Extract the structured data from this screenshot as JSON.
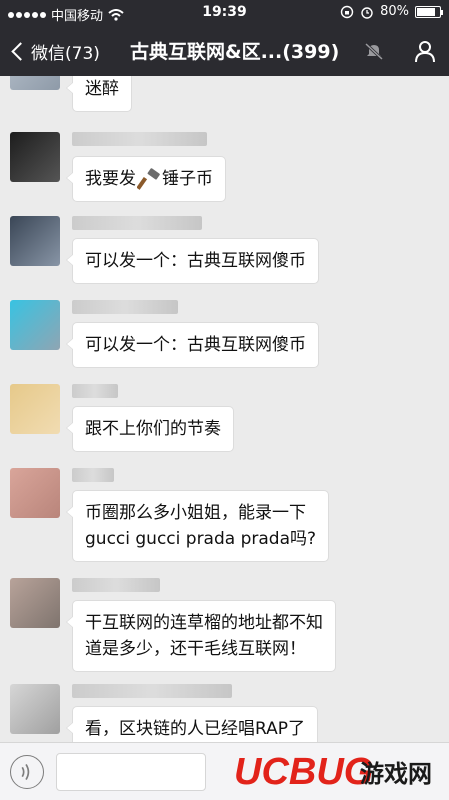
{
  "status_bar": {
    "carrier": "中国移动",
    "time": "19:39",
    "battery": "80%",
    "battery_level": 0.8
  },
  "nav": {
    "back_label": "微信(73)",
    "title": "古典互联网&区...(399)"
  },
  "messages": [
    {
      "text": "迷醉"
    },
    {
      "text_before": "我要发",
      "text_after": "锤子币"
    },
    {
      "text": "可以发一个：古典互联网傻币"
    },
    {
      "text": "可以发一个：古典互联网傻币"
    },
    {
      "text": "跟不上你们的节奏"
    },
    {
      "lines": [
        "币圈那么多小姐姐，能录一下",
        "gucci gucci prada prada吗?"
      ]
    },
    {
      "lines": [
        "干互联网的连草榴的地址都不知",
        "道是多少，还干毛线互联网！"
      ]
    },
    {
      "text": "看，区块链的人已经唱RAP了"
    }
  ],
  "watermark": {
    "brand": "UCBUG",
    "cn": "游戏网"
  },
  "colors": {
    "bar": "#2b2b30",
    "chat_bg": "#ebebeb",
    "bubble": "#ffffff",
    "logo_red": "#e2231a"
  },
  "icons": [
    "chevron-left-icon",
    "mute-icon",
    "person-icon",
    "voice-icon",
    "hammer-icon",
    "wifi-icon",
    "battery-icon"
  ]
}
